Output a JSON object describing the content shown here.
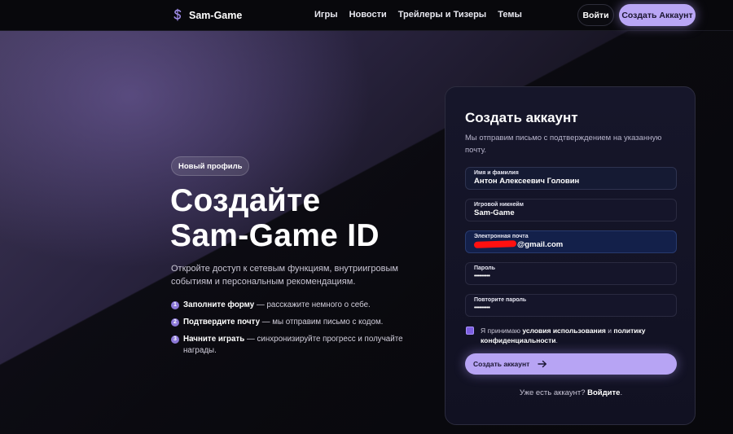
{
  "header": {
    "logo_text": "Sam-Game",
    "nav": [
      "Игры",
      "Новости",
      "Трейлеры и Тизеры",
      "Темы"
    ],
    "login_label": "Войти",
    "create_label": "Создать Аккаунт"
  },
  "hero": {
    "badge": "Новый профиль",
    "title_line1": "Создайте",
    "title_line2": "Sam-Game ID",
    "subtitle": "Откройте доступ к сетевым функциям, внутриигровым событиям и персональным рекомендациям.",
    "steps": [
      {
        "num": "1",
        "bold": "Заполните форму",
        "text": " — расскажите немного о себе."
      },
      {
        "num": "2",
        "bold": "Подтвердите почту",
        "text": " — мы отправим письмо с кодом."
      },
      {
        "num": "3",
        "bold": "Начните играть",
        "text": " — синхронизируйте прогресс и получайте награды."
      }
    ]
  },
  "form": {
    "title": "Создать аккаунт",
    "subtitle": "Мы отправим письмо с подтверждением на указанную почту.",
    "fields": [
      {
        "label": "Имя и фамилия",
        "value": "Антон Алексеевич Головин"
      },
      {
        "label": "Игровой никнейм",
        "value": "Sam-Game"
      },
      {
        "label": "Электронная почта",
        "value": "@gmail.com"
      },
      {
        "label": "Пароль",
        "value": "••••••••••"
      },
      {
        "label": "Повторите пароль",
        "value": "••••••••••"
      }
    ],
    "terms": {
      "prefix": "Я принимаю ",
      "terms_link": "условия использования",
      "and": " и ",
      "policy_link": "политику конфиденциальности",
      "suffix": "."
    },
    "submit_label": "Создать аккаунт",
    "login_prompt": "Уже есть аккаунт? ",
    "login_link": "Войдите",
    "login_suffix": "."
  },
  "colors": {
    "accent": "#b9a6f5",
    "background": "#0b0b12",
    "card": "#16162a",
    "redaction": "#ff1010"
  },
  "icons": {
    "logo": "dollar-s-icon",
    "submit": "arrow-right-icon"
  }
}
